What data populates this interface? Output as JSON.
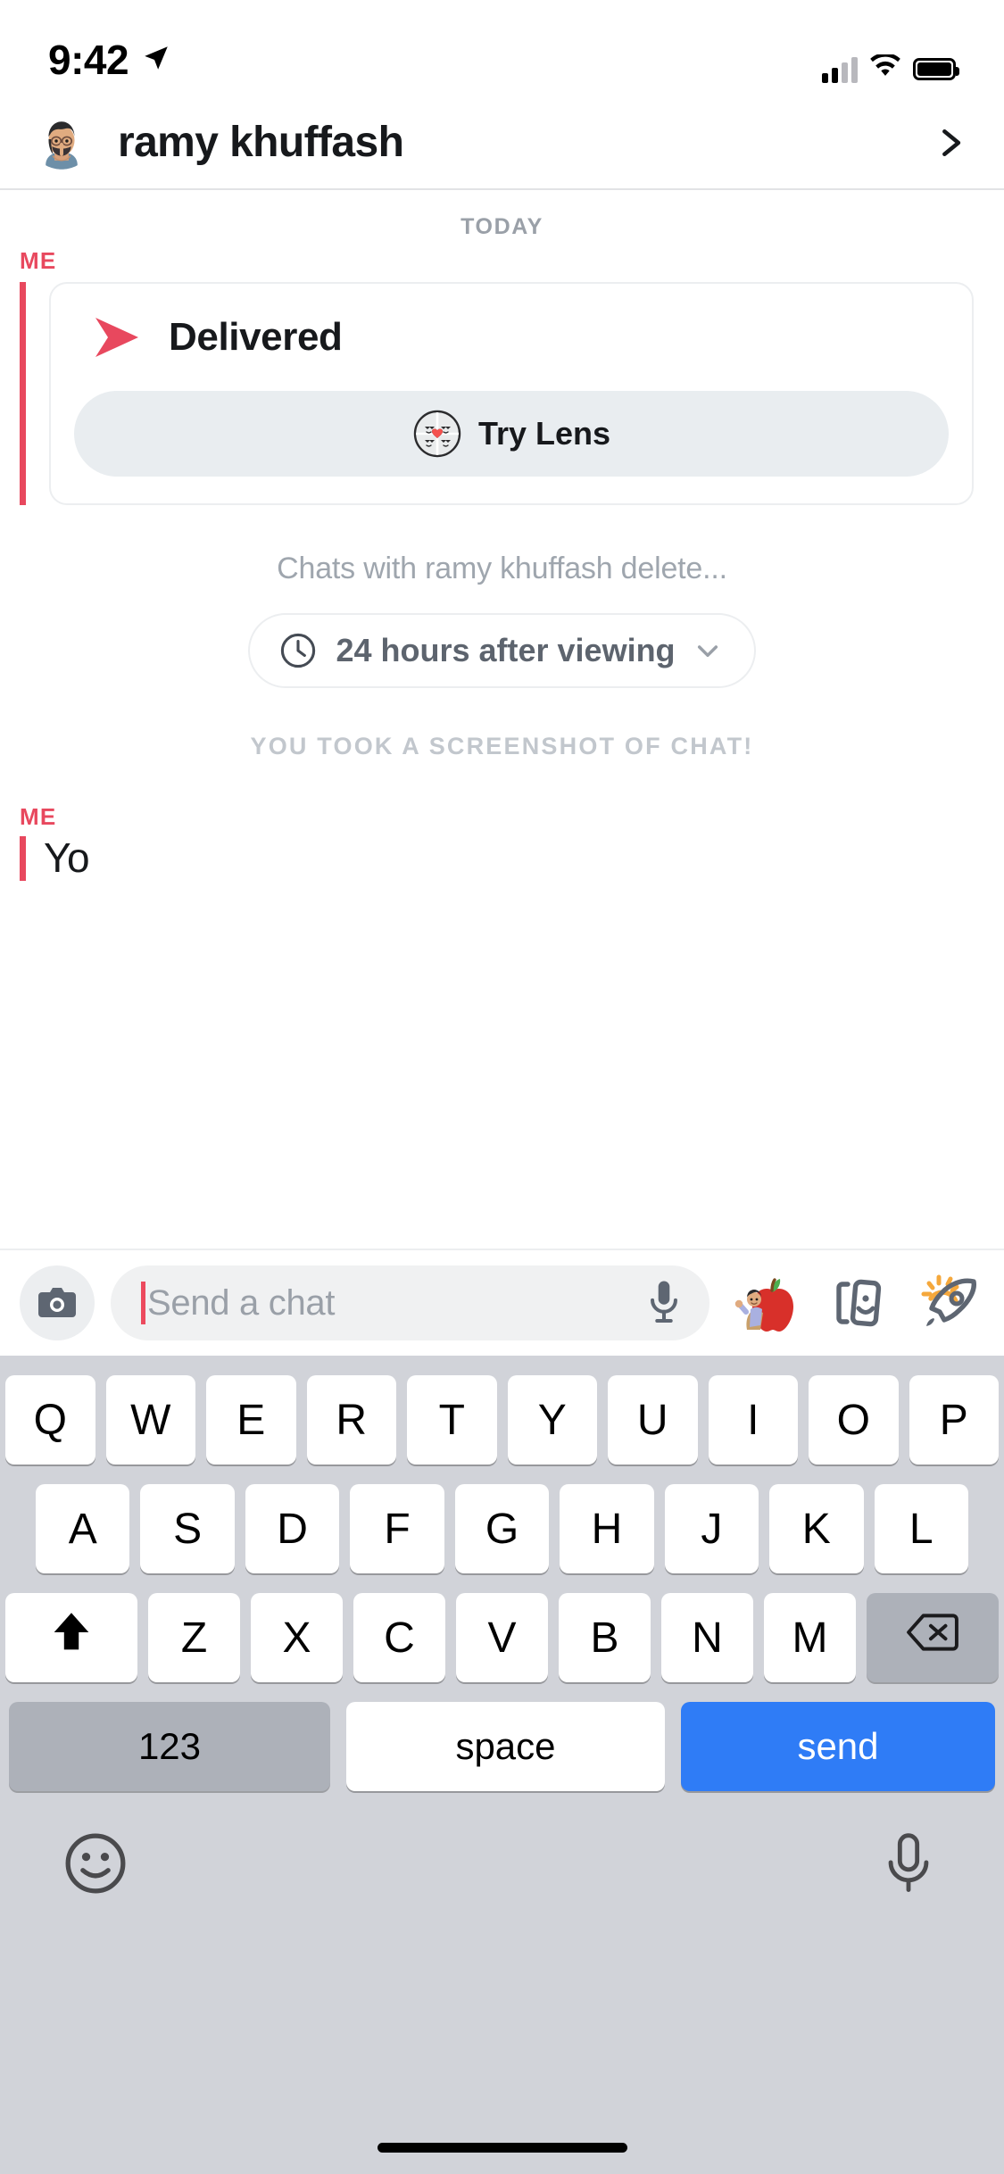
{
  "status_bar": {
    "time": "9:42",
    "location_icon": "location-arrow-icon",
    "signal_icon": "cellular-signal-icon",
    "wifi_icon": "wifi-icon",
    "battery_icon": "battery-full-icon"
  },
  "header": {
    "avatar_icon": "bitmoji-avatar",
    "name": "ramy khuffash",
    "chevron_icon": "chevron-right-icon"
  },
  "conversation": {
    "day_divider": "TODAY",
    "me_label": "ME",
    "snap_card": {
      "status_icon": "red-arrow-delivered-icon",
      "status_text": "Delivered",
      "lens_button": {
        "icon": "lens-faces-heart-icon",
        "label": "Try Lens"
      }
    },
    "delete_note": "Chats with ramy khuffash delete...",
    "timer_pill": {
      "clock_icon": "clock-icon",
      "label": "24 hours after viewing",
      "chevron_icon": "chevron-down-icon"
    },
    "screenshot_notice": "YOU TOOK A SCREENSHOT OF CHAT!",
    "me_label_2": "ME",
    "message_text": "Yo"
  },
  "input_bar": {
    "camera_icon": "camera-icon",
    "placeholder": "Send a chat",
    "value": "",
    "mic_icon": "microphone-icon",
    "tray": [
      {
        "icon": "bitmoji-apple-sticker-icon"
      },
      {
        "icon": "stickers-cards-icon"
      },
      {
        "icon": "rocket-icon"
      }
    ]
  },
  "keyboard": {
    "row1": [
      "Q",
      "W",
      "E",
      "R",
      "T",
      "Y",
      "U",
      "I",
      "O",
      "P"
    ],
    "row2": [
      "A",
      "S",
      "D",
      "F",
      "G",
      "H",
      "J",
      "K",
      "L"
    ],
    "row3": [
      "Z",
      "X",
      "C",
      "V",
      "B",
      "N",
      "M"
    ],
    "shift_icon": "shift-arrow-icon",
    "backspace_icon": "backspace-icon",
    "numbers_key": "123",
    "space_key": "space",
    "send_key": "send",
    "emoji_icon": "emoji-smiley-icon",
    "dictation_icon": "microphone-icon"
  },
  "colors": {
    "accent_red": "#e8485e",
    "send_blue": "#2f7cf6",
    "keyboard_bg": "#d1d3d9",
    "muted_text": "#9aa0a8"
  }
}
